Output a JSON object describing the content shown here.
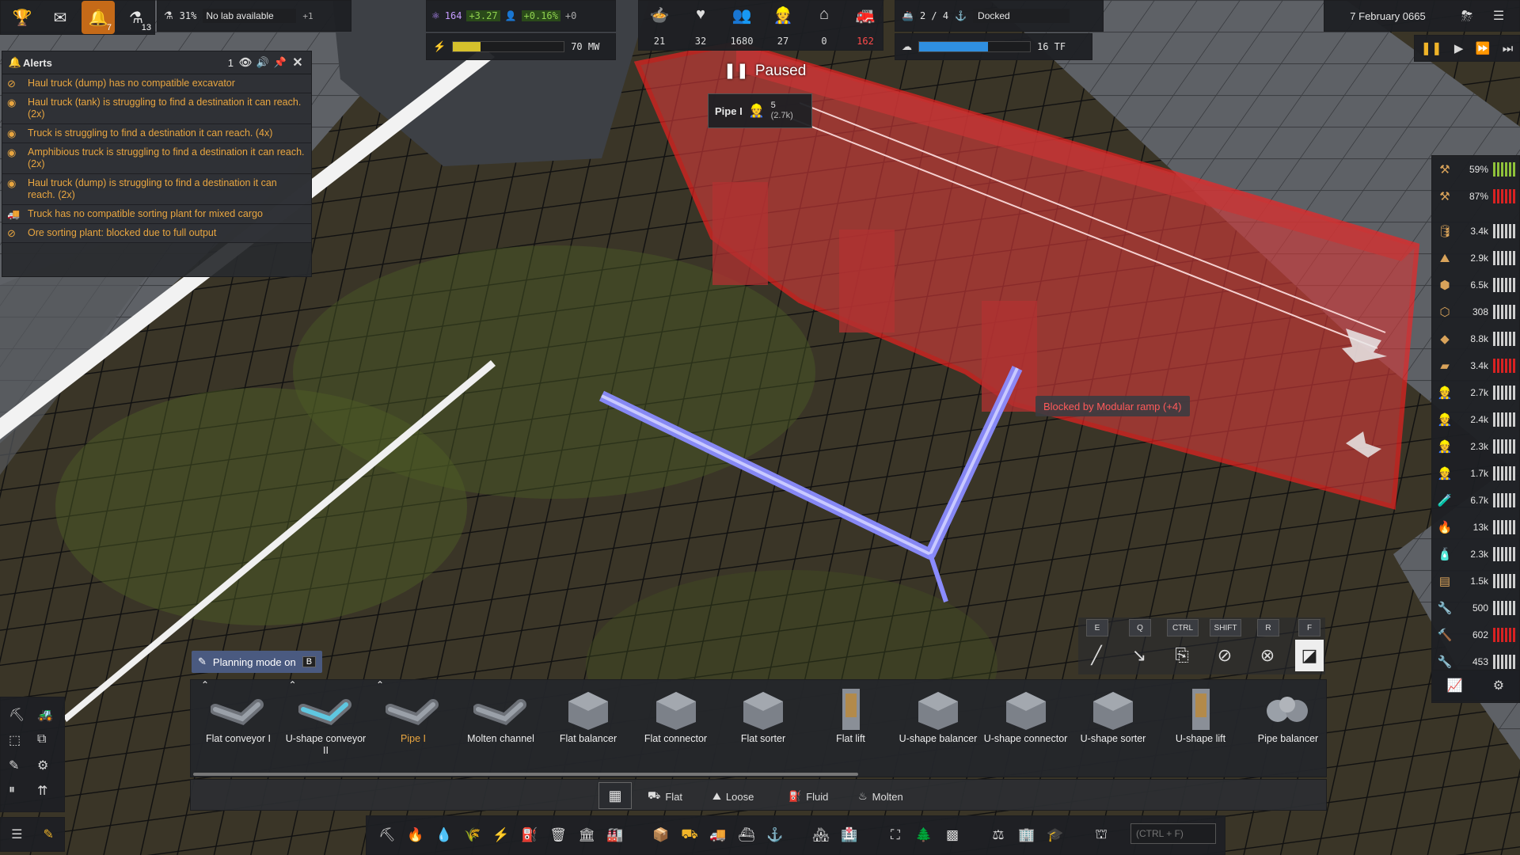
{
  "topbar": {
    "notifications_count": "7",
    "research_count": "13",
    "research_percent": "31%",
    "research_status": "No lab available",
    "research_delta": "+1",
    "unity_value": "164",
    "unity_delta": "+3.27",
    "pop_growth": "+0.16%",
    "pop_growth_delta": "+0",
    "power_value": "70 MW",
    "power_fill": 0.25,
    "stats": [
      "21",
      "32",
      "1680",
      "27",
      "0",
      "162"
    ],
    "ships": "2 / 4",
    "ship_status": "Docked",
    "compute_value": "16 TF",
    "compute_fill": 0.62,
    "date": "7 February 0665"
  },
  "paused_label": "Paused",
  "tooltip": {
    "name": "Pipe I",
    "value": "5",
    "sub": "(2.7k)"
  },
  "blocked_label": "Blocked by Modular ramp (+4)",
  "alerts": {
    "title": "Alerts",
    "count": "1",
    "items": [
      "Haul truck (dump) has no compatible excavator",
      "Haul truck (tank) is struggling to find a destination it can reach. (2x)",
      "Truck is struggling to find a destination it can reach. (4x)",
      "Amphibious truck is struggling to find a destination it can reach. (2x)",
      "Haul truck (dump) is struggling to find a destination it can reach. (2x)",
      "Truck has no compatible sorting plant for mixed cargo",
      "Ore sorting plant: blocked due to full output"
    ]
  },
  "resources": [
    {
      "value": "59%",
      "bars": "green"
    },
    {
      "value": "87%",
      "bars": "red"
    },
    {
      "value": "3.4k",
      "bars": "white"
    },
    {
      "value": "2.9k",
      "bars": "white"
    },
    {
      "value": "6.5k",
      "bars": "white"
    },
    {
      "value": "308",
      "bars": "white"
    },
    {
      "value": "8.8k",
      "bars": "white"
    },
    {
      "value": "3.4k",
      "bars": "red"
    },
    {
      "value": "2.7k",
      "bars": "white"
    },
    {
      "value": "2.4k",
      "bars": "white"
    },
    {
      "value": "2.3k",
      "bars": "white"
    },
    {
      "value": "1.7k",
      "bars": "white"
    },
    {
      "value": "6.7k",
      "bars": "white"
    },
    {
      "value": "13k",
      "bars": "white"
    },
    {
      "value": "2.3k",
      "bars": "white"
    },
    {
      "value": "1.5k",
      "bars": "white"
    },
    {
      "value": "500",
      "bars": "white"
    },
    {
      "value": "602",
      "bars": "red"
    },
    {
      "value": "453",
      "bars": "white"
    }
  ],
  "planning_mode": {
    "label": "Planning mode on",
    "key": "B"
  },
  "shortcut_keys": [
    "E",
    "Q",
    "CTRL",
    "SHIFT",
    "R",
    "F"
  ],
  "tools": [
    "Flat conveyor I",
    "U-shape conveyor II",
    "Pipe I",
    "Molten channel",
    "Flat balancer",
    "Flat connector",
    "Flat sorter",
    "Flat lift",
    "U-shape balancer",
    "U-shape connector",
    "U-shape sorter",
    "U-shape lift",
    "Pipe balancer"
  ],
  "categories": [
    "Flat",
    "Loose",
    "Fluid",
    "Molten"
  ],
  "search_placeholder": "(CTRL + F)",
  "colors": {
    "accent_orange": "#e9a640",
    "blocked_red": "#d82222",
    "pipe_blue": "#8a8cff",
    "selected_tool": "#e9a640"
  }
}
